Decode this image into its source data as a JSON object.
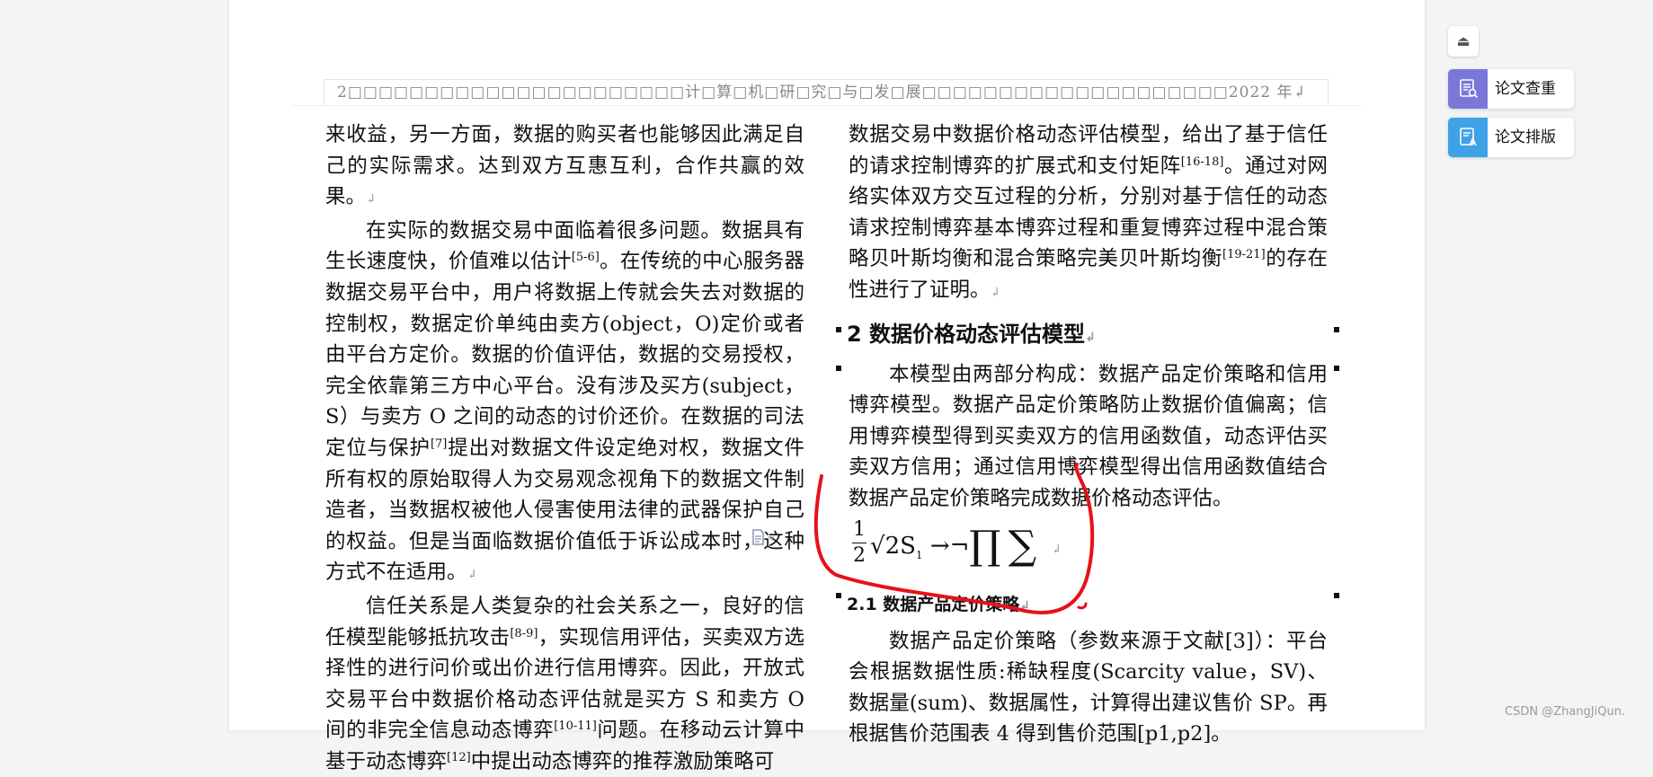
{
  "header": {
    "running_text": "2□□□□□□□□□□□□□□□□□□□□□□计□算□机□研□究□与□发□展□□□□□□□□□□□□□□□□□□□□2022 年↲"
  },
  "left_column": {
    "p1": "来收益，另一方面，数据的购买者也能够因此满足自己的实际需求。达到双方互惠互利，合作共赢的效果。",
    "p1_end": "↲",
    "p2_a": "在实际的数据交易中面临着很多问题。数据具有生长速度快，价值难以估计",
    "p2_ref1": "[5-6]",
    "p2_b": "。在传统的中心服务器数据交易平台中，用户将数据上传就会失去对数据的控制权，数据定价单纯由卖方(object，O)定价或者由平台方定价。数据的价值评估，数据的交易授权，完全依靠第三方中心平台。没有涉及买方(subject，S）与卖方 O 之间的动态的讨价还价。在数据的司法定位与保护",
    "p2_ref2": "[7]",
    "p2_c": "提出对数据文件设定绝对权，数据文件所有权的原始取得人为交易观念视角下的数据文件制造者，当数据权被他人侵害使用法律的武器保护自己的权益。但是当面临数据价值低于诉讼成本时，这种方式不在适用。",
    "p2_end": "↲",
    "p3_a": "信任关系是人类复杂的社会关系之一，良好的信任模型能够抵抗攻击",
    "p3_ref1": "[8-9]",
    "p3_b": "，实现信用评估，买卖双方选择性的进行问价或出价进行信用博弈。因此，开放式交易平台中数据价格动态评估就是买方 S 和卖方 O 间的非完全信息动态博弈",
    "p3_ref2": "[10-11]",
    "p3_c": "问题。在移动云计算中基于动态博弈",
    "p3_ref3": "[12]",
    "p3_d": "中提出动态博弈的推荐激励策略可"
  },
  "right_column": {
    "p1_a": "数据交易中数据价格动态评估模型，给出了基于信任的请求控制博弈的扩展式和支付矩阵",
    "p1_ref1": "[16-18]",
    "p1_b": "。通过对网络实体双方交互过程的分析，分别对基于信任的动态请求控制博弈基本博弈过程和重复博弈过程中混合策略贝叶斯均衡和混合策略完美贝叶斯均衡",
    "p1_ref2": "[19-21]",
    "p1_c": "的存在性进行了证明。",
    "p1_end": "↲",
    "h2": "2 数据价格动态评估模型",
    "h2_end": "↲",
    "p2": "本模型由两部分构成：数据产品定价策略和信用博弈模型。数据产品定价策略防止数据价值偏离；信用博弈模型得到买卖双方的信用函数值，动态评估买卖双方信用；通过信用博弈模型得出信用函数值结合数据产品定价策略完成数据价格动态评估。",
    "formula": {
      "numerator": "1",
      "denominator": "2",
      "body": "√2S",
      "sub": "1",
      "tail": " →¬",
      "prod": "∏",
      "sum": "∑",
      "cursor": "↲"
    },
    "h3": "2.1 数据产品定价策略",
    "h3_end": "↲",
    "p3": "数据产品定价策略（参数来源于文献[3]）：平台会根据数据性质:稀缺程度(Scarcity value，SV)、数据量(sum)、数据属性，计算得出建议售价 SP。再根据售价范围表 4 得到售价范围[p1,p2]。"
  },
  "tools": {
    "check_label": "论文查重",
    "layout_label": "论文排版",
    "collapse_icon": "eject-icon"
  },
  "watermark": "CSDN @ZhangJiQun.",
  "colors": {
    "check_icon_bg": "#7b77d9",
    "layout_icon_bg": "#3ea2e6",
    "annotation": "#e8101c"
  }
}
